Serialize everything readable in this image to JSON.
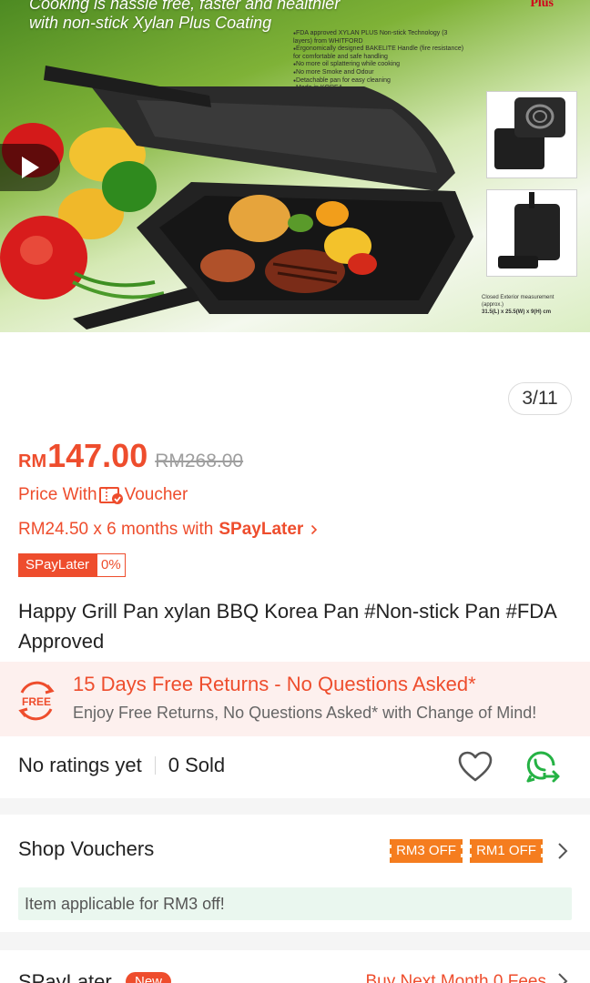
{
  "hero": {
    "banner_line1": "Cooking is hassle free, faster and healthier",
    "banner_line2": "with non-stick Xylan Plus Coating",
    "brand": "Plus",
    "features": [
      "FDA approved XYLAN PLUS Non-stick Technology (3 layers) from WHITFORD",
      "Ergonomically designed BAKELITE Handle (fire resistance) for comfortable and safe handling",
      "No more oil splattering while cooking",
      "No more Smoke and Odour",
      "Detachable pan for easy cleaning",
      "Made in KOREA"
    ],
    "measure_label": "Closed Exterior measurement (approx.)",
    "measure_value": "31.5(L) x 25.5(W) x 9(H) cm",
    "play_icon": "play-icon"
  },
  "image_counter": "3/11",
  "price": {
    "currency": "RM",
    "value": "147.00",
    "original": "RM268.00"
  },
  "voucher_line": {
    "prefix": "Price With",
    "suffix": "Voucher"
  },
  "spaylater": {
    "installment": "RM24.50 x 6 months with",
    "brand": "SPayLater",
    "badge_name": "SPayLater",
    "badge_pct": "0%"
  },
  "product_title": "Happy Grill Pan xylan BBQ Korea Pan #Non-stick Pan #FDA Approved",
  "returns": {
    "badge": "FREE",
    "title": "15 Days Free Returns - No Questions Asked*",
    "subtitle": "Enjoy Free Returns, No Questions Asked* with Change of Mind!"
  },
  "ratings": {
    "rating_text": "No ratings yet",
    "sold_text": "0 Sold"
  },
  "shop_vouchers": {
    "label": "Shop Vouchers",
    "tags": [
      "RM3 OFF",
      "RM1 OFF"
    ],
    "applicable": "Item applicable for RM3 off!"
  },
  "spaylater_bottom": {
    "label": "SPayLater",
    "badge": "New",
    "right_text": "Buy Next Month 0 Fees"
  },
  "colors": {
    "accent": "#ee4d2d",
    "voucher_orange": "#f57d1f",
    "whatsapp_green": "#25b244",
    "returns_bg": "#fdf0ee",
    "applicable_bg": "#eaf7ef"
  }
}
